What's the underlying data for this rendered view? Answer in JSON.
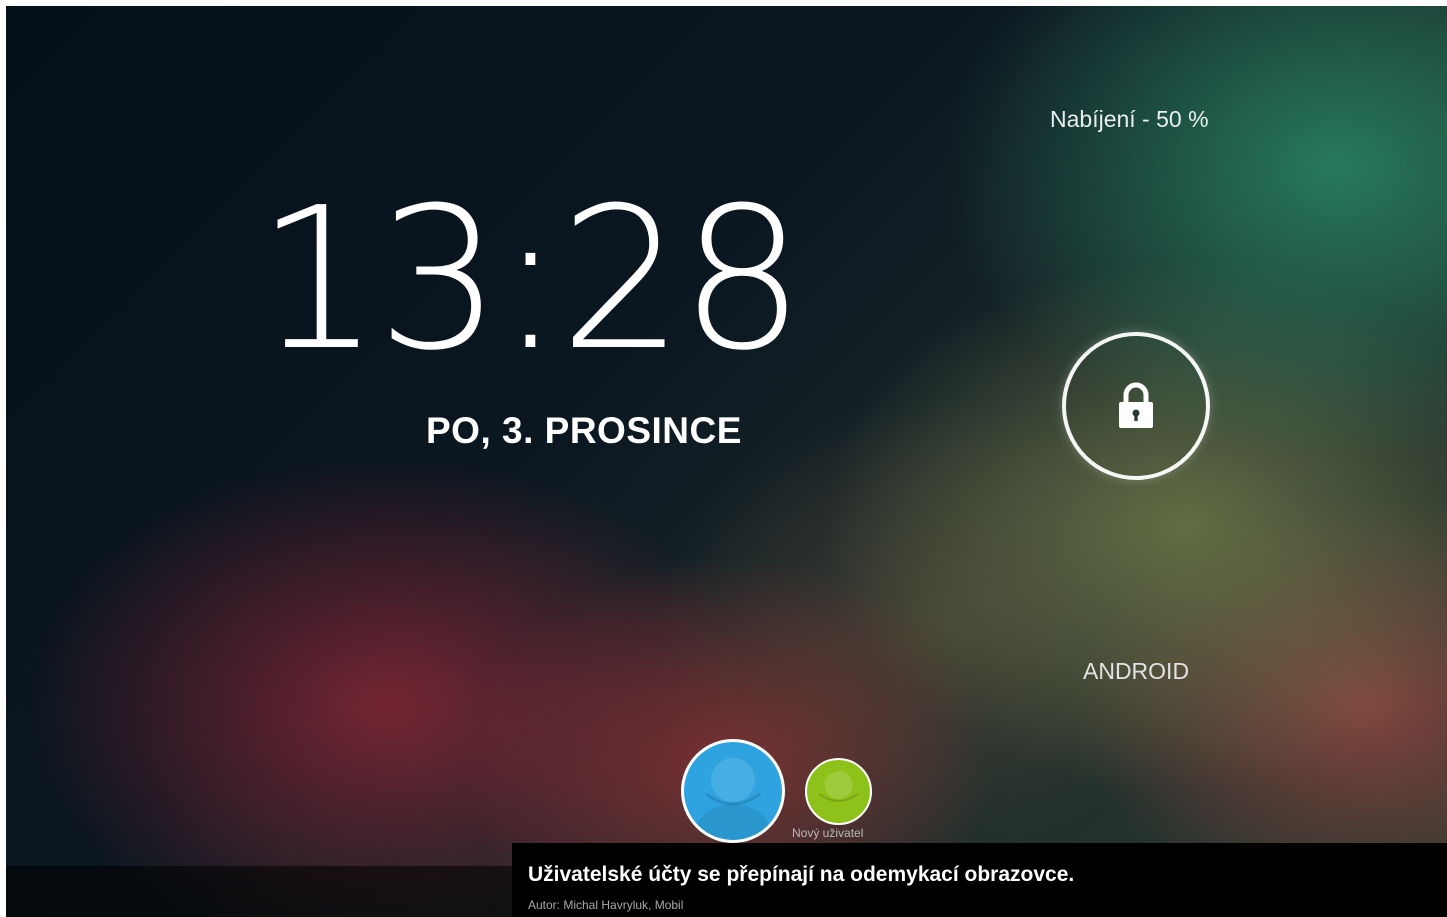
{
  "status": {
    "charging_text": "Nabíjení - 50 %"
  },
  "clock": {
    "time": "13:28",
    "date": "PO, 3. PROSINCE"
  },
  "lock": {
    "icon": "lock-icon"
  },
  "owner": {
    "label": "ANDROID"
  },
  "users": {
    "current_color": "#2ea3e0",
    "new_user_color": "#8cc21a",
    "new_user_label": "Nový uživatel"
  },
  "caption": {
    "title": "Uživatelské účty se přepínají na odemykací obrazovce.",
    "author": "Autor: Michal Havryluk, Mobil"
  }
}
